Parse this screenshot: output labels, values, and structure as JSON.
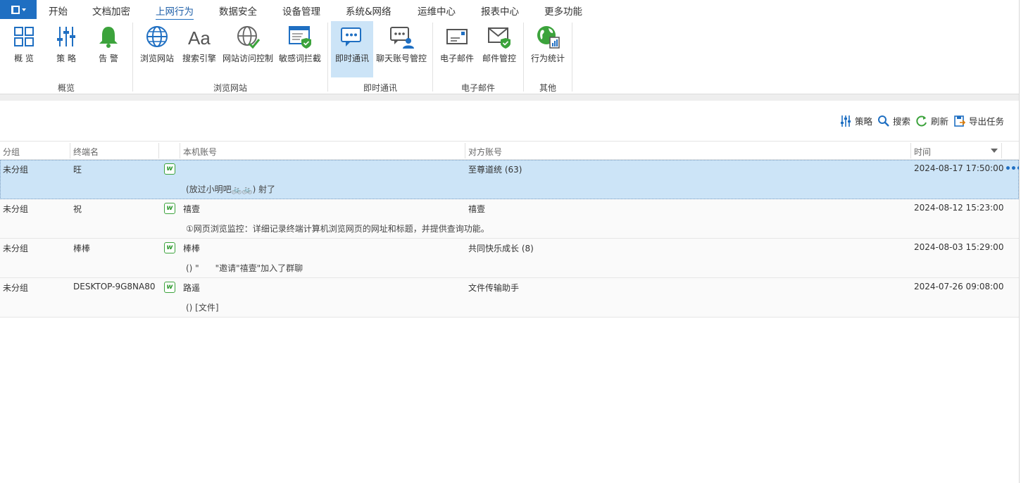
{
  "menubar": {
    "items": [
      "开始",
      "文档加密",
      "上网行为",
      "数据安全",
      "设备管理",
      "系统&网络",
      "运维中心",
      "报表中心",
      "更多功能"
    ],
    "active_index": 2
  },
  "ribbon": {
    "buttons": [
      {
        "label": "概 览",
        "icon": "overview-grid-icon"
      },
      {
        "label": "策 略",
        "icon": "policy-sliders-icon"
      },
      {
        "label": "告 警",
        "icon": "alert-bell-icon"
      },
      {
        "label": "浏览网站",
        "icon": "globe-icon"
      },
      {
        "label": "搜索引擎",
        "icon": "font-aa-icon"
      },
      {
        "label": "网站访问控制",
        "icon": "globe-check-icon"
      },
      {
        "label": "敏感词拦截",
        "icon": "window-shield-icon"
      },
      {
        "label": "即时通讯",
        "icon": "chat-bubble-icon"
      },
      {
        "label": "聊天账号管控",
        "icon": "chat-user-icon"
      },
      {
        "label": "电子邮件",
        "icon": "email-icon"
      },
      {
        "label": "邮件管控",
        "icon": "email-shield-icon"
      },
      {
        "label": "行为统计",
        "icon": "globe-stats-icon"
      }
    ],
    "groups": [
      "概览",
      "浏览网站",
      "即时通讯",
      "电子邮件",
      "其他"
    ],
    "selected_button": "即时通讯"
  },
  "toolbar": {
    "policy": "策略",
    "search": "搜索",
    "refresh": "刷新",
    "export": "导出任务"
  },
  "table": {
    "columns": [
      "分组",
      "终端名",
      "本机账号",
      "对方账号",
      "时间"
    ],
    "rows": [
      {
        "group": "未分组",
        "terminal": "旺",
        "local_account": "",
        "peer_account": "至尊道统 (63)",
        "time": "2024-08-17 17:50:00",
        "message": "(放过小明吧🚲🚲) 射了",
        "selected": true
      },
      {
        "group": "未分组",
        "terminal": "祝",
        "local_account": "禧壹",
        "peer_account": "禧壹",
        "time": "2024-08-12 15:23:00",
        "message": "①网页浏览监控：详细记录终端计算机浏览网页的网址和标题，并提供查询功能。",
        "selected": false
      },
      {
        "group": "未分组",
        "terminal": "棒棒",
        "local_account": "棒棒",
        "peer_account": "共同快乐成长 (8)",
        "time": "2024-08-03 15:29:00",
        "message": "() \"      \"邀请\"禧壹\"加入了群聊",
        "selected": false
      },
      {
        "group": "未分组",
        "terminal": "DESKTOP-9G8NA80",
        "local_account": "路遥",
        "peer_account": "文件传输助手",
        "time": "2024-07-26 09:08:00",
        "message": "() [文件]",
        "selected": false
      }
    ],
    "app_icon": "wechat-work-icon",
    "app_icon_glyph": "w",
    "more_glyph": "•••"
  },
  "colors": {
    "accent": "#1f6fc2",
    "selected_bg": "#cce4f7",
    "icon_green": "#3ca33c"
  }
}
